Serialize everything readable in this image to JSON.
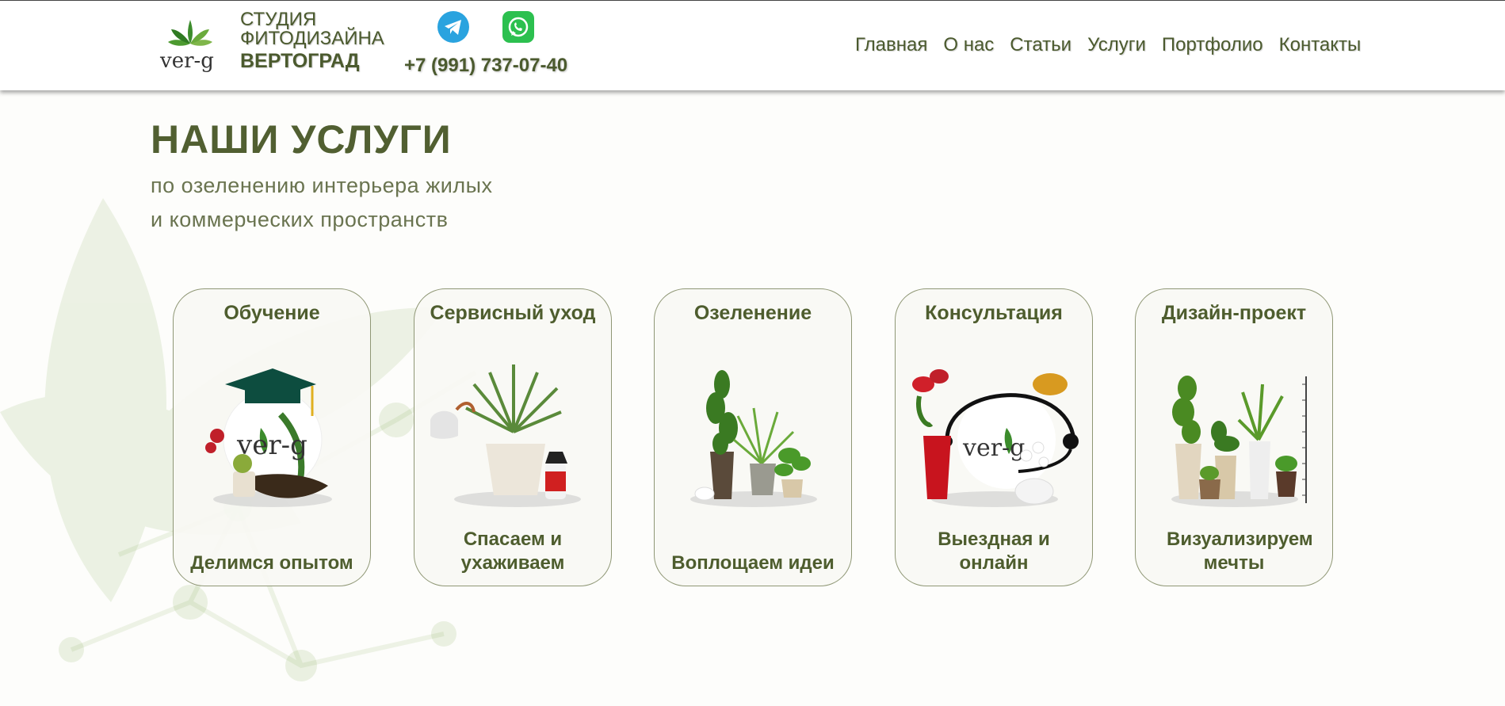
{
  "header": {
    "logo_text": "ver-g",
    "brand_line1": "СТУДИЯ",
    "brand_line2": "ФИТОДИЗАЙНА",
    "brand_line3": "ВЕРТОГРАД",
    "phone": "+7 (991) 737-07-40",
    "messengers": [
      {
        "name": "telegram-icon",
        "color": "#2aa3df"
      },
      {
        "name": "whatsapp-icon",
        "color": "#2cc04f"
      }
    ]
  },
  "nav": {
    "items": [
      "Главная",
      "О нас",
      "Статьи",
      "Услуги",
      "Портфолио",
      "Контакты"
    ]
  },
  "hero": {
    "title": "НАШИ УСЛУГИ",
    "subtitle_line1": "по озеленению интерьера жилых",
    "subtitle_line2": "и коммерческих пространств"
  },
  "services": [
    {
      "title": "Обучение",
      "caption": "Делимся опытом"
    },
    {
      "title": "Сервисный уход",
      "caption": "Спасаем и ухаживаем"
    },
    {
      "title": "Озеленение",
      "caption": "Воплощаем идеи"
    },
    {
      "title": "Консультация",
      "caption": "Выездная и онлайн"
    },
    {
      "title": "Дизайн-проект",
      "caption": "Визуализируем мечты"
    }
  ],
  "colors": {
    "brand_text": "#4b5a2e",
    "leaf_green": "#3a8a2a",
    "card_border": "#8f9775"
  }
}
